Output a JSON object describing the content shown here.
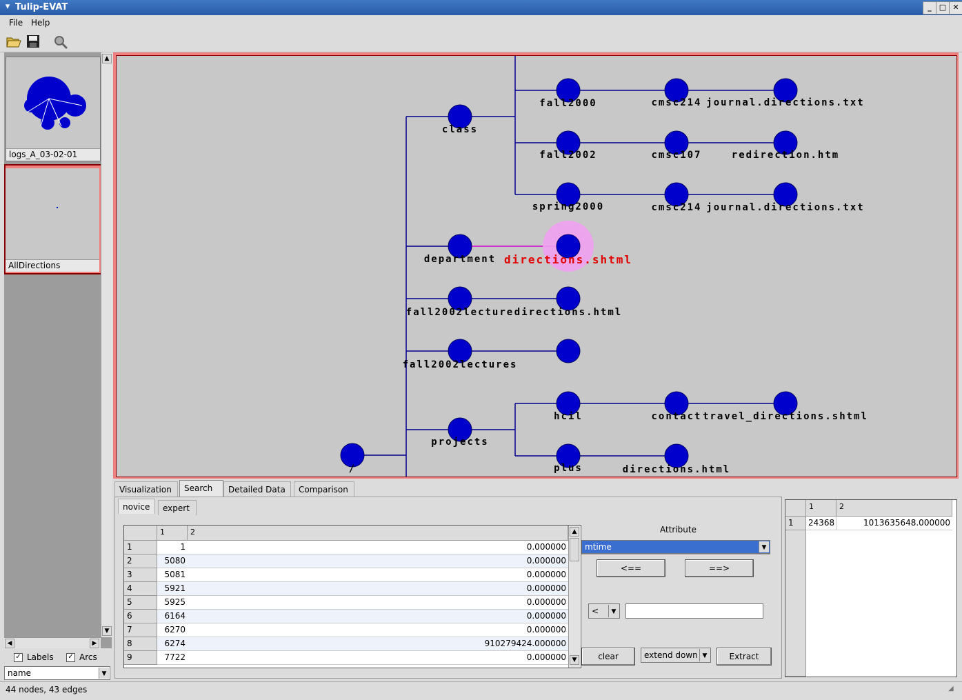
{
  "window": {
    "title": "Tulip-EVAT"
  },
  "menu": {
    "file": "File",
    "help": "Help"
  },
  "toolbar": {
    "open_icon": "open-folder-icon",
    "save_icon": "floppy-save-icon",
    "search_icon": "magnifier-icon"
  },
  "left": {
    "thumbs": [
      {
        "label": "logs_A_03-02-01"
      },
      {
        "label": "AllDirections"
      }
    ],
    "labels_check": "Labels",
    "arcs_check": "Arcs",
    "property_select": "name"
  },
  "graph": {
    "highlight_color": "#e00000",
    "node_color": "#0000cc",
    "labels": {
      "root": "/",
      "class": "class",
      "fall2000": "fall2000",
      "cmsc214a": "cmsc214",
      "journal1": "journal.directions.txt",
      "fall2002": "fall2002",
      "cmsc107": "cmsc107",
      "redirection": "redirection.htm",
      "spring2000": "spring2000",
      "cmsc214b": "cmsc214",
      "journal2": "journal.directions.txt",
      "department": "department",
      "directions_shtml": "directions.shtml",
      "fall2002lecture": "fall2002lecture",
      "directions_html1": "directions.html",
      "fall2002lectures": "fall2002lectures",
      "projects": "projects",
      "hcil": "hcil",
      "contact": "contact",
      "travel": "travel_directions.shtml",
      "plus": "plus",
      "directions_html2": "directions.html"
    }
  },
  "tabs": {
    "visualization": "Visualization",
    "search": "Search",
    "detailed": "Detailed Data",
    "comparison": "Comparison"
  },
  "subtabs": {
    "novice": "novice",
    "expert": "expert"
  },
  "results": {
    "col1": "1",
    "col2": "2",
    "rows": [
      {
        "n": "1",
        "a": "1",
        "b": "0.000000"
      },
      {
        "n": "2",
        "a": "5080",
        "b": "0.000000"
      },
      {
        "n": "3",
        "a": "5081",
        "b": "0.000000"
      },
      {
        "n": "4",
        "a": "5921",
        "b": "0.000000"
      },
      {
        "n": "5",
        "a": "5925",
        "b": "0.000000"
      },
      {
        "n": "6",
        "a": "6164",
        "b": "0.000000"
      },
      {
        "n": "7",
        "a": "6270",
        "b": "0.000000"
      },
      {
        "n": "8",
        "a": "6274",
        "b": "910279424.000000"
      },
      {
        "n": "9",
        "a": "7722",
        "b": "0.000000"
      }
    ]
  },
  "controls": {
    "attribute_label": "Attribute",
    "attribute_value": "mtime",
    "left_btn": "<==",
    "right_btn": "==>",
    "operator": "<",
    "value_input": "",
    "clear_btn": "clear",
    "extend": "extend down",
    "extract_btn": "Extract"
  },
  "right_table": {
    "col1": "1",
    "col2": "2",
    "row_n": "1",
    "a": "24368",
    "b": "1013635648.000000"
  },
  "status": "44 nodes, 43 edges"
}
